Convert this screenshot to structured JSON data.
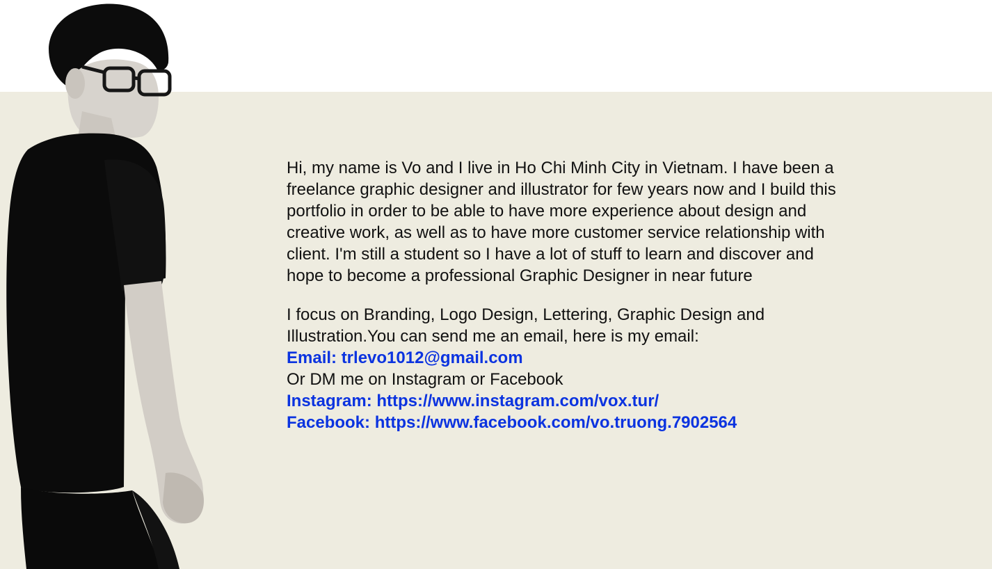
{
  "about": {
    "intro": "Hi, my name is Vo and I live in Ho Chi Minh City in Vietnam. I have been a freelance graphic designer and illustrator for few years now and I build this portfolio in order to be able to have more experience about design and creative work, as well as to have more customer service relationship with client. I'm still a student so I have a lot of stuff to learn and discover and hope to become a professional Graphic Designer in near future",
    "focus": "I focus on Branding, Logo Design, Lettering, Graphic Design and Illustration.You can send me an email, here is my email:",
    "email_link": "Email: trlevo1012@gmail.com",
    "dm_text": "Or DM me on Instagram or Facebook",
    "instagram_link": "Instagram: https://www.instagram.com/vox.tur/",
    "facebook_link": "Facebook: https://www.facebook.com/vo.truong.7902564"
  },
  "colors": {
    "panel": "#eeece0",
    "link": "#0b33e0",
    "text": "#111111"
  }
}
